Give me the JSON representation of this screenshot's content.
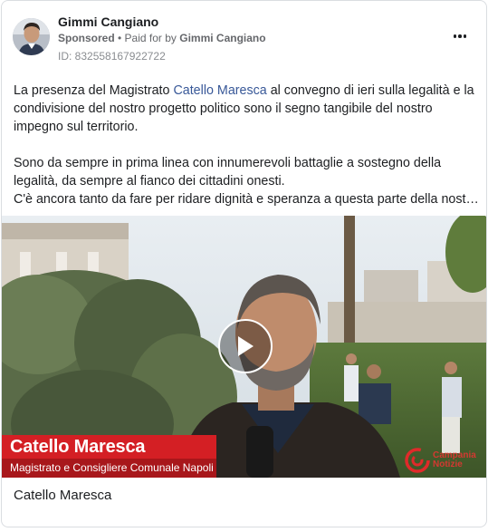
{
  "post": {
    "author": "Gimmi Cangiano",
    "sponsored_label": "Sponsored",
    "separator": " • ",
    "paid_for_prefix": "Paid for by ",
    "paid_for_name": "Gimmi Cangiano",
    "ad_id": "ID: 832558167922722",
    "more_icon": "more-horizontal-icon"
  },
  "body": {
    "p1_before_link": "La presenza del Magistrato ",
    "p1_link": "Catello Maresca",
    "p1_after_link": " al convegno di ieri sulla legalità e la condivisione del nostro progetto politico sono il segno tangibile del nostro impegno sul territorio.",
    "p2_line1": "Sono da sempre in prima linea con innumerevoli battaglie a sostegno della legalità, da sempre al fianco dei cittadini onesti.",
    "p2_line2": "C'è ancora tanto da fare per ridare dignità e speranza a questa parte della nostra…"
  },
  "video": {
    "lower_third_name": "Catello Maresca",
    "lower_third_role": "Magistrato e Consigliere Comunale Napoli",
    "brand_line1": "Campania",
    "brand_line2": "Notizie",
    "play_icon": "play-icon",
    "accent_red": "#d41f24"
  },
  "caption": "Catello Maresca",
  "colors": {
    "text": "#1c1e21",
    "secondary": "#65676b",
    "link": "#385898"
  }
}
